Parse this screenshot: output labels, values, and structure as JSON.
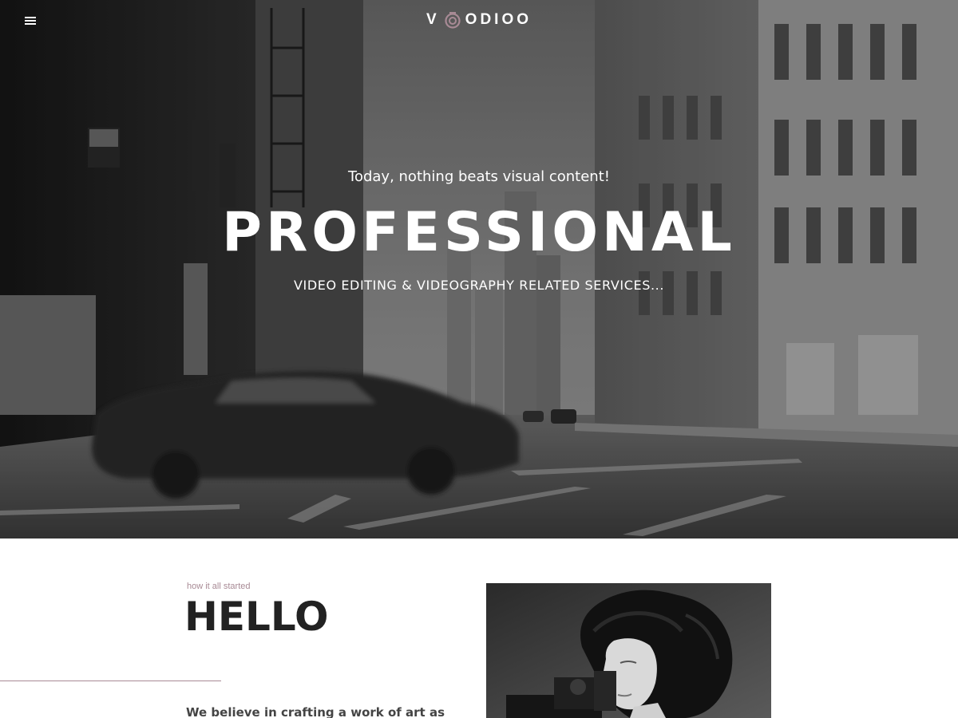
{
  "header": {
    "logo_text_left": "V",
    "logo_text_right": "ODIOO",
    "menu_icon": "hamburger-menu-icon"
  },
  "hero": {
    "tagline": "Today, nothing beats visual content!",
    "title": "PROFESSIONAL",
    "subtitle": "VIDEO EDITING & VIDEOGRAPHY RELATED SERVICES...",
    "background": "black-and-white city street with blurred car"
  },
  "about": {
    "eyebrow": "how it all started",
    "title": "HELLO",
    "text": "We believe in crafting a work of art as",
    "photo": "black-and-white portrait of woman with vintage movie camera"
  },
  "colors": {
    "accent": "#a88a95",
    "text_dark": "#222222",
    "hero_text": "#ffffff"
  }
}
